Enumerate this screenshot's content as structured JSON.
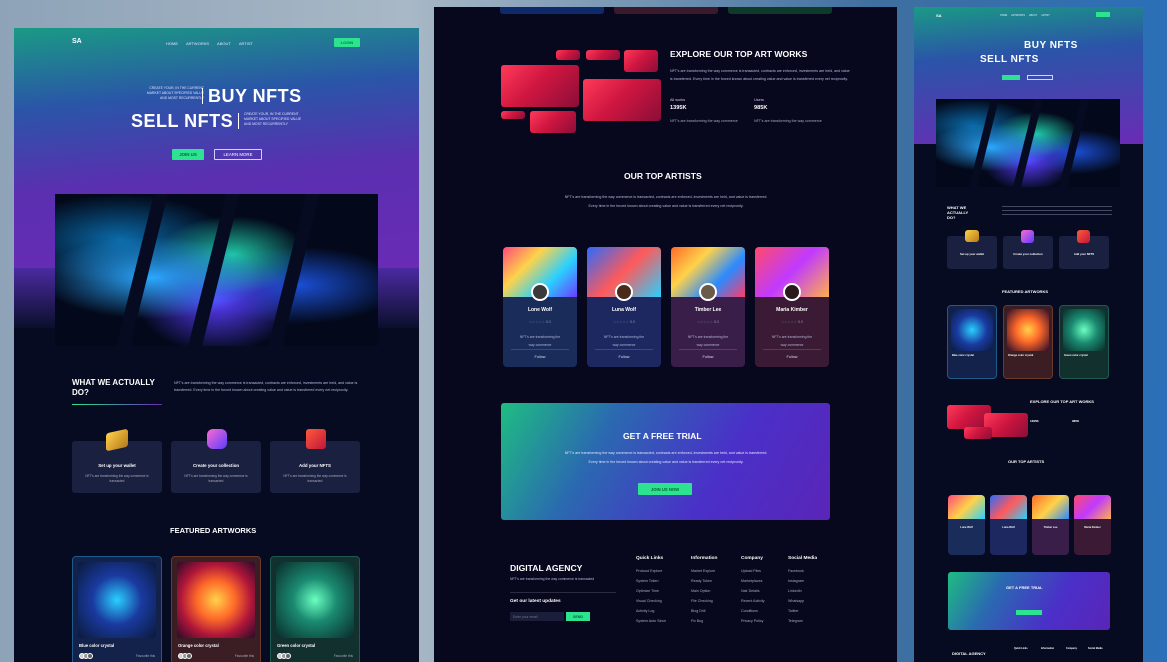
{
  "left": {
    "logo": "SA",
    "nav": [
      "HOME",
      "ARTWORKS",
      "ABOUT",
      "ARTIST"
    ],
    "nav_button": "LOGIN",
    "hero_small_1": "CREATE YOUR, IN THE CURRENT MARKET ABOUT SPECIFIED VALUE AND MOST RECURRENTLY",
    "hero_title_1": "BUY NFTS",
    "hero_title_2": "SELL NFTS",
    "hero_small_2": "CREATE YOUR, IN THE CURRENT MARKET ABOUT SPECIFIED VALUE AND MOST RECURRENTLY",
    "btn_join": "JOIN US",
    "btn_learn": "LEARN MORE",
    "what_title_1": "WHAT WE ACTUALLY",
    "what_title_2": "DO?",
    "what_text": "NFT's are transforming the way commerce is transacted, contracts are enforced, investments are held, and value is transferred. Every time in the forced known about creating value and value is transferred every net reciprocity.",
    "steps": [
      {
        "title": "Set up your wallet",
        "desc": "NFT's are transforming the way commerce is transacted"
      },
      {
        "title": "Create your collection",
        "desc": "NFT's are transforming the way commerce is transacted"
      },
      {
        "title": "Add your NFTS",
        "desc": "NFT's are transforming the way commerce is transacted"
      }
    ],
    "featured_title": "FEATURED ARTWORKS",
    "artworks": [
      {
        "name": "Blue color crystal",
        "fav": "Favourite this"
      },
      {
        "name": "Orange color crystal",
        "fav": "Favourite this"
      },
      {
        "name": "Green color crystal",
        "fav": "Favourite this"
      }
    ]
  },
  "mid": {
    "explore_title": "EXPLORE OUR TOP ART WORKS",
    "explore_text": "NFT's are transforming the way commerce is transacted, contracts are enforced, investments are held, and value is transferred. Every time in the forced known about creating value and value is transferred every net reciprocity.",
    "stats": [
      {
        "label": "All works",
        "value": "1395K",
        "desc": "NFT's are transforming the way commerce"
      },
      {
        "label": "Users",
        "value": "985K",
        "desc": "NFT's are transforming the way commerce"
      }
    ],
    "artists_title": "OUR TOP ARTISTS",
    "artists_text": "NFT's are transforming the way commerce is transacted, contracts are enforced, investments are held, and value is transferred. Every time in the forced known about creating value and value is transferred every net reciprocity.",
    "artists": [
      {
        "name": "Lone Wolf",
        "rating": "☆☆☆☆☆ 5.0",
        "desc": "NFT's are transforming the way commerce",
        "follow": "Follow"
      },
      {
        "name": "Luna Wolf",
        "rating": "☆☆☆☆☆ 5.0",
        "desc": "NFT's are transforming the way commerce",
        "follow": "Follow"
      },
      {
        "name": "Timber Lee",
        "rating": "☆☆☆☆☆ 5.0",
        "desc": "NFT's are transforming the way commerce",
        "follow": "Follow"
      },
      {
        "name": "Maria Kimber",
        "rating": "☆☆☆☆☆ 5.0",
        "desc": "NFT's are transforming the way commerce",
        "follow": "Follow"
      }
    ],
    "trial_title": "GET A FREE TRIAL",
    "trial_text": "NFT's are transforming the way commerce is transacted, contracts are enforced, investments are held, and value is transferred. Every time in the forced known about creating value and value is transferred every net reciprocity.",
    "trial_button": "JOIN US NOW",
    "footer": {
      "brand": "DIGITAL AGENCY",
      "brand_text": "NFT's are transforming the way commerce is transacted",
      "newsletter_title": "Get our latest updates",
      "email_placeholder": "Enter your email",
      "send": "SEND",
      "columns": [
        {
          "title": "Quick Links",
          "items": [
            "Protocol Explore",
            "System Token",
            "Optimize Time",
            "Visual Checking",
            "Activity Log",
            "System Auto Since"
          ]
        },
        {
          "title": "Information",
          "items": [
            "Market Explore",
            "Ready Token",
            "Main Option",
            "File Checking",
            "Blog Drill",
            "Fix Bug"
          ]
        },
        {
          "title": "Company",
          "items": [
            "Upload Files",
            "Marketplaces",
            "Nair Details",
            "Recent Activity",
            "Conditions",
            "Privacy Policy"
          ]
        },
        {
          "title": "Social Media",
          "items": [
            "Facebook",
            "Instagram",
            "LinkedIn",
            "Whatsapp",
            "Twitter",
            "Telegram"
          ]
        }
      ]
    }
  },
  "right": {
    "logo": "SA",
    "nav": [
      "HOME",
      "ARTWORKS",
      "ABOUT",
      "ARTIST"
    ],
    "hero_title_1": "BUY NFTS",
    "hero_title_2": "SELL NFTS",
    "what_title": "WHAT WE ACTUALLY DO?",
    "steps": [
      "Set up your wallet",
      "Create your collection",
      "Add your NFTS"
    ],
    "featured_title": "FEATURED ARTWORKS",
    "artworks": [
      "Blue color crystal",
      "Orange color crystal",
      "Green color crystal"
    ],
    "explore_title": "EXPLORE OUR TOP ART WORKS",
    "stats": [
      {
        "label": "All works",
        "value": "1395K"
      },
      {
        "label": "Users",
        "value": "985K"
      }
    ],
    "artists_title": "OUR TOP ARTISTS",
    "artists": [
      "Lone Wolf",
      "Luna Wolf",
      "Timber Lee",
      "Maria Kimber"
    ],
    "trial_title": "GET A FREE TRIAL",
    "footer_brand": "DIGITAL AGENCY",
    "footer_cols": [
      "Quick Links",
      "Information",
      "Company",
      "Social Media"
    ]
  },
  "colors": {
    "accent_green": "#2de38f",
    "brand_purple": "#6a2bb5",
    "background_dark": "#070b22"
  }
}
